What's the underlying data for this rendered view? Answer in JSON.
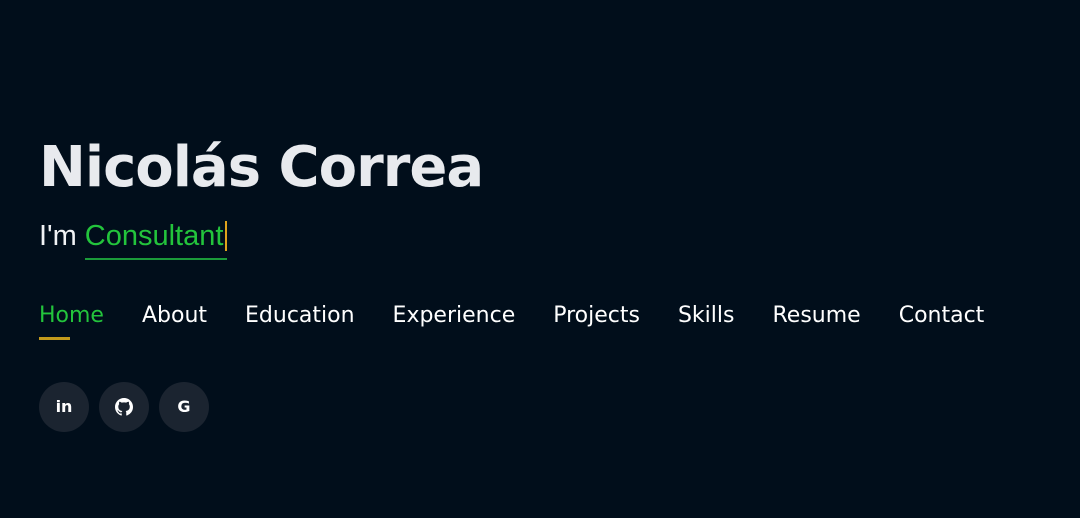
{
  "hero": {
    "name": "Nicolás Correa",
    "tagline_prefix": "I'm",
    "tagline_typed": "Consultant"
  },
  "nav": {
    "items": [
      {
        "label": "Home",
        "active": true
      },
      {
        "label": "About",
        "active": false
      },
      {
        "label": "Education",
        "active": false
      },
      {
        "label": "Experience",
        "active": false
      },
      {
        "label": "Projects",
        "active": false
      },
      {
        "label": "Skills",
        "active": false
      },
      {
        "label": "Resume",
        "active": false
      },
      {
        "label": "Contact",
        "active": false
      }
    ]
  },
  "social": {
    "links": [
      {
        "icon": "linkedin-icon",
        "glyph": "in"
      },
      {
        "icon": "github-icon",
        "glyph": ""
      },
      {
        "icon": "google-icon",
        "glyph": "G"
      }
    ]
  },
  "colors": {
    "background": "#010e1b",
    "accent_green": "#23c43c",
    "accent_gold": "#c39a1c",
    "text": "#ffffff",
    "social_bg": "#1b2430"
  }
}
